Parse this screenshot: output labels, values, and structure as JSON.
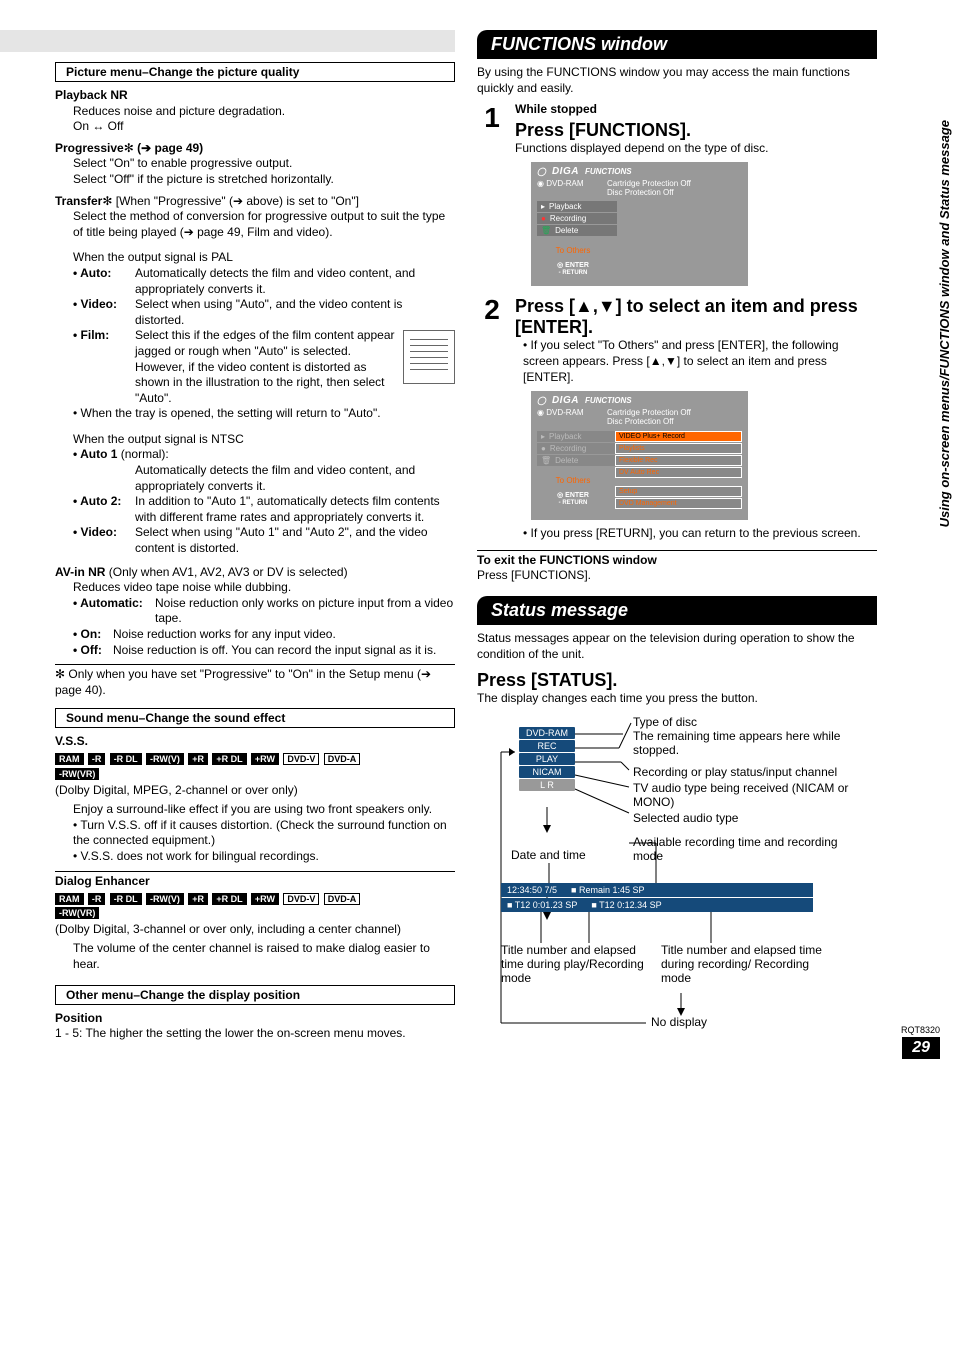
{
  "left": {
    "picture_hdr": "Picture menu–Change the picture quality",
    "playback_nr": "Playback NR",
    "playback_nr_desc": "Reduces noise and picture degradation.",
    "playback_nr_onoff": "On ↔ Off",
    "progressive_hdr": "Progressive",
    "progressive_ref": "(➔ page 49)",
    "progressive_on": "Select \"On\" to enable progressive output.",
    "progressive_off": "Select \"Off\" if the picture is stretched horizontally.",
    "transfer_hdr": "Transfer",
    "transfer_cond": "[When \"Progressive\" (➔ above) is set to \"On\"]",
    "transfer_desc": "Select the method of conversion for progressive output to suit the type of title being played (➔ page 49, Film and video).",
    "pal_line": "When the output signal is PAL",
    "auto_lbl": "• Auto:",
    "auto_txt": "Automatically detects the film and video content, and appropriately converts it.",
    "video_lbl": "• Video:",
    "video_txt": "Select when using \"Auto\", and the video content is distorted.",
    "film_lbl": "• Film:",
    "film_txt": "Select this if the edges of the film content appear jagged or rough when \"Auto\" is selected. However, if the video content is distorted as shown in the illustration to the right, then select \"Auto\".",
    "tray_note": "• When the tray is opened, the setting will return to \"Auto\".",
    "ntsc_line": "When the output signal is NTSC",
    "auto1_lbl": "• Auto 1",
    "auto1_norm": " (normal):",
    "auto1_txt": "Automatically detects the film and video content, and appropriately converts it.",
    "auto2_lbl": "• Auto 2:",
    "auto2_txt": "In addition to \"Auto 1\", automatically detects film contents with different frame rates and appropriately converts it.",
    "video2_lbl": "• Video:",
    "video2_txt": "Select when using \"Auto 1\" and \"Auto 2\", and the video content is distorted.",
    "avin_hdr": "AV-in NR",
    "avin_cond": " (Only when AV1, AV2, AV3 or DV is selected)",
    "avin_desc": "Reduces video tape noise while dubbing.",
    "auto_nr_lbl": "• Automatic:",
    "auto_nr_txt": "Noise reduction only works on picture input from a video tape.",
    "on_lbl": "• On:",
    "on_txt": "Noise reduction works for any input video.",
    "off_lbl": "• Off:",
    "off_txt": "Noise reduction is off. You can record the input signal as it is.",
    "footnote": "Only when you have set \"Progressive\" to \"On\" in the Setup menu (➔ page 40).",
    "sound_hdr": "Sound menu–Change the sound effect",
    "vss": "V.S.S.",
    "vss_cond": "(Dolby Digital, MPEG, 2-channel or over only)",
    "vss_enjoy": "Enjoy a surround-like effect if you are using two front speakers only.",
    "vss_b1": "• Turn V.S.S. off if it causes distortion. (Check the surround function on the connected equipment.)",
    "vss_b2": "• V.S.S. does not work for bilingual recordings.",
    "dialog": "Dialog Enhancer",
    "dialog_cond": "(Dolby Digital, 3-channel or over only, including a center channel)",
    "dialog_desc": "The volume of the center channel is raised to make dialog easier to hear.",
    "other_hdr": "Other menu–Change the display position",
    "position": "Position",
    "position_desc": "1 - 5: The higher the setting the lower the on-screen menu moves.",
    "badges": [
      "RAM",
      "-R",
      "-R DL",
      "-RW(V)",
      "+R",
      "+R DL",
      "+RW",
      "DVD-V",
      "DVD-A"
    ],
    "badges2": "-RW(VR)"
  },
  "right": {
    "functions_title": "FUNCTIONS window",
    "functions_intro": "By using the FUNCTIONS window you may access the main functions quickly and easily.",
    "step1_while": "While stopped",
    "step1_press": "Press [FUNCTIONS].",
    "step1_desc": "Functions displayed depend on the type of disc.",
    "step2_title": "Press [▲,▼] to select an item and press [ENTER].",
    "step2_b1": "• If you select \"To Others\" and press [ENTER], the following screen appears. Press [▲,▼] to select an item and press [ENTER].",
    "step2_b2": "• If you press [RETURN], you can return to the previous screen.",
    "exit_hdr": "To exit the FUNCTIONS window",
    "exit_txt": "Press [FUNCTIONS].",
    "status_title": "Status message",
    "status_intro": "Status messages appear on the television during operation to show the condition of the unit.",
    "press_status": "Press [STATUS].",
    "press_status_desc": "The display changes each time you press the button.",
    "sd_type": "Type of disc",
    "sd_remaining": "The remaining time appears here while stopped.",
    "sd_recplay": "Recording or play status/input channel",
    "sd_tvaudio": "TV audio type being received (NICAM or MONO)",
    "sd_selaudio": "Selected audio type",
    "sd_avail": "Available recording time and recording mode",
    "sd_datetime": "Date and time",
    "sd_tnum_left": "Title number and elapsed time during play/Recording mode",
    "sd_tnum_right": "Title number and elapsed time during recording/ Recording mode",
    "sd_nodisp": "No display",
    "strip1_a": "12:34:50  7/5",
    "strip1_b": "■ Remain   1:45  SP",
    "strip2_a": "■ T12  0:01.23  SP",
    "strip2_b": "■ T12   0:12.34  SP",
    "pill_dvd": "DVD-RAM",
    "pill_rec": "REC",
    "pill_play": "PLAY",
    "pill_nicam": "NICAM",
    "pill_lr": "L R",
    "fw": {
      "brand": "DIGA",
      "func": "FUNCTIONS",
      "dvd": "DVD-RAM",
      "cart": "Cartridge Protection   Off",
      "disc": "Disc Protection   Off",
      "playback": "Playback",
      "recording": "Recording",
      "delete": "Delete",
      "toothers": "To Others",
      "enter": "ENTER",
      "return": "RETURN",
      "vplus": "VIDEO Plus+ Record",
      "plist": "Playlists",
      "flex": "Flexible Rec",
      "dvauto": "DV Auto Rec",
      "setup": "Setup",
      "dvdmgmt": "DVD Management"
    }
  },
  "sidetab": "Using on-screen menus/FUNCTIONS window and Status message",
  "rqt": "RQT8320",
  "pagenum": "29"
}
